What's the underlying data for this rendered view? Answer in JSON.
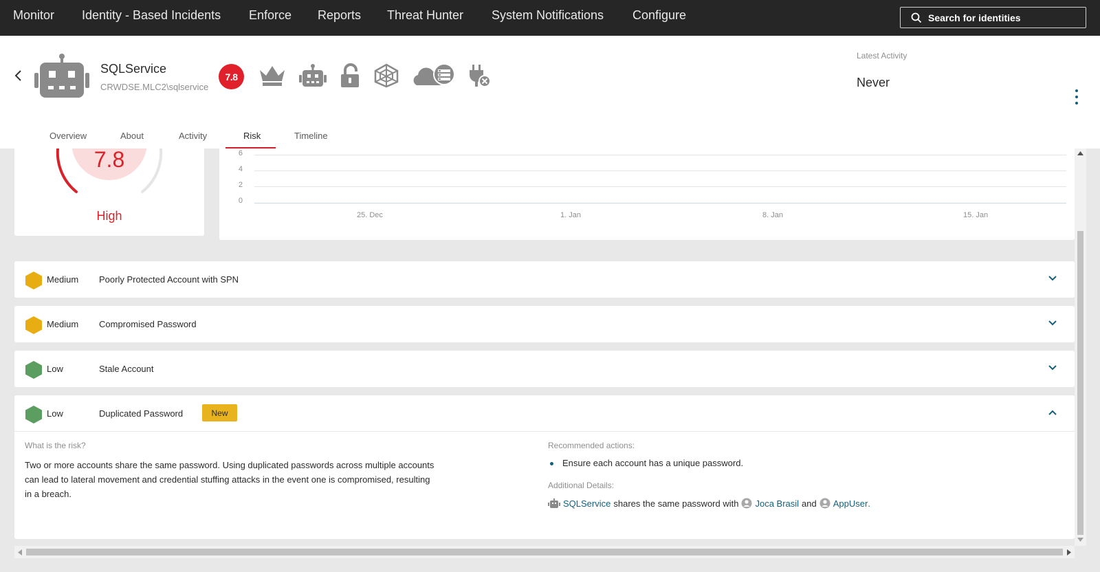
{
  "nav": {
    "items": [
      "Monitor",
      "Identity - Based Incidents",
      "Enforce",
      "Reports",
      "Threat Hunter",
      "System Notifications",
      "Configure"
    ],
    "search_label": "Search for identities"
  },
  "identity": {
    "name": "SQLService",
    "account": "CRWDSE.MLC2\\sqlservice",
    "risk_score": "7.8",
    "latest_activity_label": "Latest Activity",
    "latest_activity_value": "Never"
  },
  "tabs": [
    "Overview",
    "About",
    "Activity",
    "Risk",
    "Timeline"
  ],
  "active_tab": "Risk",
  "score_card": {
    "score": "7.8",
    "level": "High",
    "color": "#d8232a"
  },
  "chart_data": {
    "type": "line",
    "title": "",
    "xlabel": "",
    "ylabel": "",
    "y_ticks": [
      "6",
      "4",
      "2",
      "0"
    ],
    "x_ticks": [
      "25. Dec",
      "1. Jan",
      "8. Jan",
      "15. Jan"
    ],
    "ylim": [
      0,
      6
    ],
    "grid": true,
    "series": []
  },
  "risks": [
    {
      "severity": "Medium",
      "name": "Poorly Protected Account with SPN",
      "color": "#e9ad14",
      "expanded": false
    },
    {
      "severity": "Medium",
      "name": "Compromised Password",
      "color": "#e9ad14",
      "expanded": false
    },
    {
      "severity": "Low",
      "name": "Stale Account",
      "color": "#5b9e5f",
      "expanded": false
    },
    {
      "severity": "Low",
      "name": "Duplicated Password",
      "color": "#5b9e5f",
      "expanded": true,
      "badge": "New"
    }
  ],
  "detail": {
    "what_label": "What is the risk?",
    "what_text": "Two or more accounts share the same password. Using duplicated passwords across multiple accounts can lead to lateral movement and credential stuffing attacks in the event one is compromised, resulting in a breach.",
    "rec_label": "Recommended actions:",
    "rec_items": [
      "Ensure each account has a unique password."
    ],
    "additional_label": "Additional Details:",
    "link1": "SQLService",
    "text1": "shares the same password with",
    "link2": "Joca Brasil",
    "text2": "and",
    "link3": "AppUser",
    "text3": "."
  },
  "icons": [
    "back-arrow-icon",
    "robot-avatar-icon",
    "crown-icon",
    "robot-icon",
    "unlock-icon",
    "web-icon",
    "cloud-icon",
    "unplugged-icon",
    "chevron-down-icon",
    "chevron-up-icon",
    "user-icon"
  ]
}
